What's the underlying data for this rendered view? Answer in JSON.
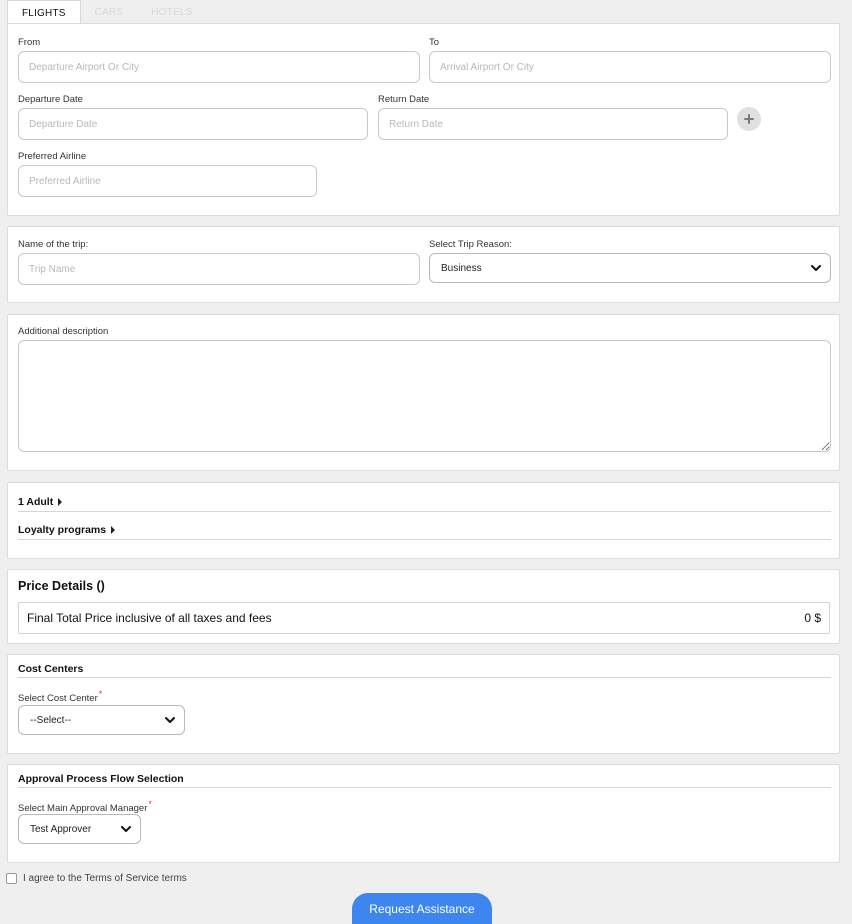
{
  "tabs": [
    "FLIGHTS",
    "CARS",
    "HOTELS"
  ],
  "flights": {
    "from_label": "From",
    "from_placeholder": "Departure Airport Or City",
    "to_label": "To",
    "to_placeholder": "Arrival Airport Or City",
    "departure_date_label": "Departure Date",
    "departure_date_placeholder": "Departure Date",
    "return_date_label": "Return Date",
    "return_date_placeholder": "Return Date",
    "add_icon": "plus-icon",
    "airline_label": "Preferred Airline",
    "airline_placeholder": "Preferred Airline"
  },
  "trip": {
    "name_label": "Name of the trip:",
    "name_placeholder": "Trip Name",
    "reason_label": "Select Trip Reason:",
    "reason_value": "Business"
  },
  "description": {
    "label": "Additional description"
  },
  "travelers": {
    "adults": "1 Adult",
    "loyalty": "Loyalty programs"
  },
  "price": {
    "title": "Price Details ()",
    "total_label": "Final Total Price inclusive of all taxes and fees",
    "total_value": "0 $"
  },
  "cost_centers": {
    "title": "Cost Centers",
    "select_label": "Select Cost Center",
    "required_mark": "*",
    "select_value": "--Select--"
  },
  "approval": {
    "title": "Approval Process Flow Selection",
    "select_label": "Select Main Approval Manager",
    "required_mark": "*",
    "select_value": "Test Approver"
  },
  "agree_text": "I agree to the Terms of Service terms",
  "submit_label": "Request Assistance",
  "colors": {
    "accent": "#3d86f0",
    "required": "#e04040"
  }
}
